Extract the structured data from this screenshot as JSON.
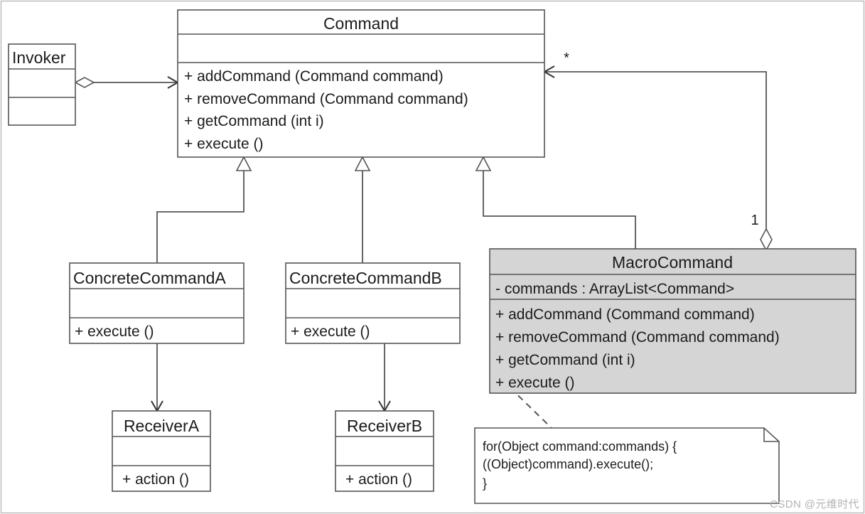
{
  "diagram": {
    "title": "Command Pattern UML Class Diagram",
    "watermark": "CSDN @元维时代",
    "colors": {
      "stroke": "#555555",
      "text": "#1b1b1b",
      "white_fill": "#ffffff",
      "gray_fill": "#d5d5d5",
      "frame": "#b9b9b9",
      "watermark": "#b3b3b3"
    }
  },
  "classes": {
    "invoker": {
      "name": "Invoker",
      "attributes": [],
      "operations": []
    },
    "command": {
      "name": "Command",
      "attributes": [],
      "operations": [
        "+  addCommand (Command command)",
        "+  removeCommand (Command command)",
        "+  getCommand (int i)",
        "+  execute ()"
      ]
    },
    "concrete_command_a": {
      "name": "ConcreteCommandA",
      "attributes": [],
      "operations": [
        "+  execute ()"
      ]
    },
    "concrete_command_b": {
      "name": "ConcreteCommandB",
      "attributes": [],
      "operations": [
        "+  execute ()"
      ]
    },
    "macro_command": {
      "name": "MacroCommand",
      "attributes": [
        "-  commands  :  ArrayList<Command>"
      ],
      "operations": [
        "+  addCommand (Command command)",
        "+  removeCommand (Command command)",
        "+  getCommand (int i)",
        "+  execute ()"
      ]
    },
    "receiver_a": {
      "name": "ReceiverA",
      "attributes": [],
      "operations": [
        "+  action ()"
      ]
    },
    "receiver_b": {
      "name": "ReceiverB",
      "attributes": [],
      "operations": [
        "+  action ()"
      ]
    }
  },
  "relationships": {
    "invoker_to_command": {
      "type": "aggregation",
      "source": "Invoker",
      "target": "Command",
      "multiplicity_source": "",
      "multiplicity_target": ""
    },
    "macro_to_command": {
      "type": "aggregation",
      "source": "MacroCommand",
      "target": "Command",
      "multiplicity_source": "1",
      "multiplicity_target": "*"
    },
    "generalizations": [
      {
        "source": "ConcreteCommandA",
        "target": "Command"
      },
      {
        "source": "ConcreteCommandB",
        "target": "Command"
      },
      {
        "source": "MacroCommand",
        "target": "Command"
      }
    ],
    "associations": [
      {
        "source": "ConcreteCommandA",
        "target": "ReceiverA"
      },
      {
        "source": "ConcreteCommandB",
        "target": "ReceiverB"
      }
    ],
    "note_link": {
      "source": "MacroCommand.execute ()",
      "target": "note"
    }
  },
  "note": {
    "lines": [
      "for(Object command:commands) {",
      "   ((Object)command).execute();",
      "}"
    ]
  }
}
